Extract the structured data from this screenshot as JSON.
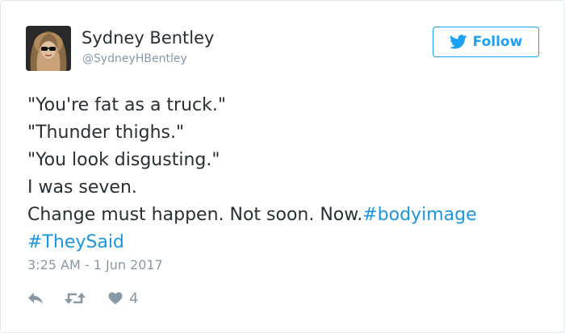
{
  "tweet": {
    "author": {
      "name": "Sydney Bentley",
      "handle": "@SydneyHBentley",
      "avatar_icon": "user-avatar"
    },
    "follow_label": "Follow",
    "lines": [
      "\"You're fat as a truck.\"",
      "\"Thunder thighs.\"",
      "\"You look disgusting.\"",
      "I was seven.",
      "Change must happen. Not soon. Now."
    ],
    "hashtags": [
      "#bodyimage",
      "#TheySaid"
    ],
    "timestamp": "3:25 AM - 1 Jun 2017",
    "actions": {
      "reply_icon": "reply-icon",
      "retweet_icon": "retweet-icon",
      "like_icon": "heart-icon",
      "like_count": "4"
    }
  },
  "colors": {
    "link": "#1b95e0",
    "brand": "#1da1f2",
    "text": "#292f33",
    "muted": "#8899a6",
    "border": "#e1e8ed"
  }
}
